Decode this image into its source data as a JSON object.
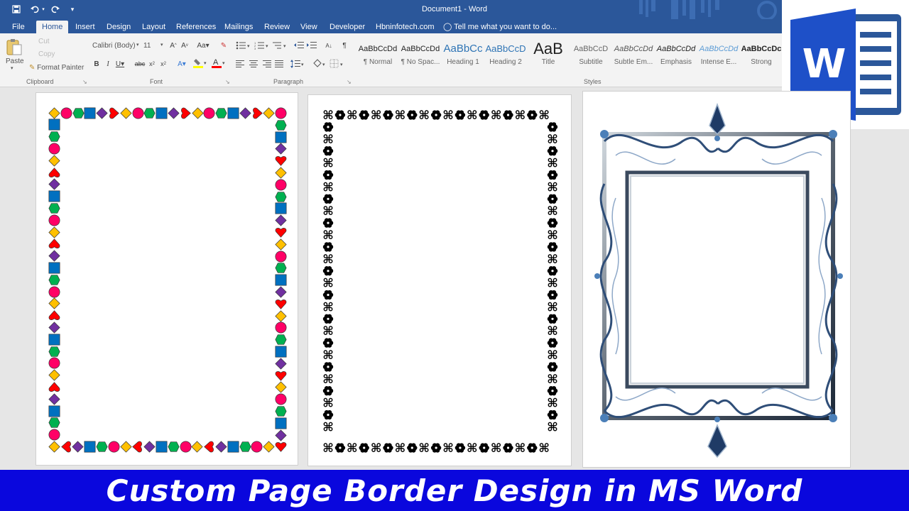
{
  "window": {
    "title": "Document1 - Word"
  },
  "quick_access": {
    "icons": [
      "save-icon",
      "undo-icon",
      "redo-icon",
      "customize-icon"
    ]
  },
  "tabs": [
    {
      "label": "File"
    },
    {
      "label": "Home"
    },
    {
      "label": "Insert"
    },
    {
      "label": "Design"
    },
    {
      "label": "Layout"
    },
    {
      "label": "References"
    },
    {
      "label": "Mailings"
    },
    {
      "label": "Review"
    },
    {
      "label": "View"
    },
    {
      "label": "Developer"
    },
    {
      "label": "Hbninfotech.com"
    }
  ],
  "tell_me": "Tell me what you want to do...",
  "clipboard": {
    "paste": "Paste",
    "cut": "Cut",
    "copy": "Copy",
    "format_painter": "Format Painter",
    "group": "Clipboard"
  },
  "font": {
    "name": "Calibri (Body)",
    "size": "11",
    "group": "Font"
  },
  "paragraph": {
    "group": "Paragraph"
  },
  "styles": {
    "group": "Styles",
    "items": [
      {
        "sample": "AaBbCcDd",
        "name": "¶ Normal"
      },
      {
        "sample": "AaBbCcDd",
        "name": "¶ No Spac..."
      },
      {
        "sample": "AaBbCc",
        "name": "Heading 1"
      },
      {
        "sample": "AaBbCcD",
        "name": "Heading 2"
      },
      {
        "sample": "AaB",
        "name": "Title"
      },
      {
        "sample": "AaBbCcD",
        "name": "Subtitle"
      },
      {
        "sample": "AaBbCcDd",
        "name": "Subtle Em..."
      },
      {
        "sample": "AaBbCcDd",
        "name": "Emphasis"
      },
      {
        "sample": "AaBbCcDd",
        "name": "Intense E..."
      },
      {
        "sample": "AaBbCcDc",
        "name": "Strong"
      }
    ]
  },
  "logo": {
    "letter": "W"
  },
  "banner": {
    "text": "Custom Page Border Design in MS Word"
  },
  "colors": {
    "word_blue": "#2b579a",
    "banner_blue": "#0a07dd",
    "shape_colors": [
      "#ffc000",
      "#ff0066",
      "#00b050",
      "#0070c0",
      "#7030a0",
      "#ff0000"
    ]
  }
}
